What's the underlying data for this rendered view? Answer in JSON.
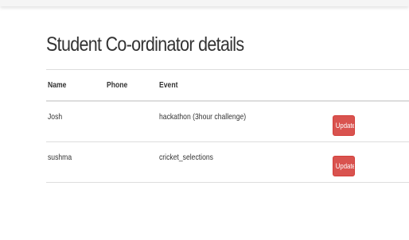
{
  "page": {
    "title": "Student Co-ordinator details"
  },
  "colors": {
    "danger_button": "#d9534f",
    "border": "#dddddd",
    "text": "#333333"
  },
  "table": {
    "columns": [
      "Name",
      "Phone",
      "Event",
      ""
    ],
    "rows": [
      {
        "name": "Josh",
        "phone": "",
        "event": "hackathon (3hour challenge)",
        "action": "Update"
      },
      {
        "name": "sushma",
        "phone": "",
        "event": "cricket_selections",
        "action": "Update"
      }
    ]
  }
}
